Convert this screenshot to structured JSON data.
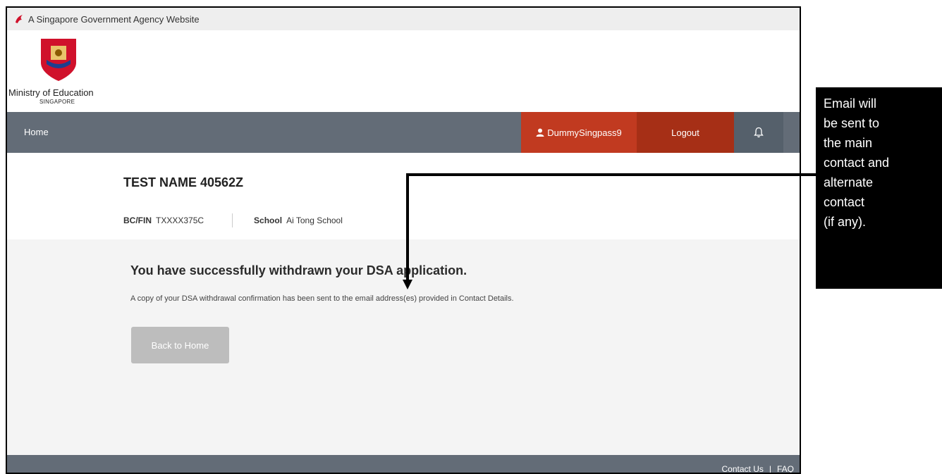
{
  "gov_banner": {
    "text": "A Singapore Government Agency Website"
  },
  "brand": {
    "name": "Ministry of Education",
    "sub": "SINGAPORE"
  },
  "nav": {
    "home": "Home",
    "user": "DummySingpass9",
    "logout": "Logout"
  },
  "profile": {
    "name": "TEST NAME 40562Z",
    "bcfin_label": "BC/FIN",
    "bcfin_value": "TXXXX375C",
    "school_label": "School",
    "school_value": "Ai Tong School"
  },
  "content": {
    "heading": "You have successfully withdrawn your DSA application.",
    "message": "A copy of your DSA withdrawal confirmation has been sent to the email address(es) provided in Contact Details.",
    "back_button": "Back to Home"
  },
  "footer": {
    "contact": "Contact Us",
    "divider": "|",
    "faq": "FAQ"
  },
  "callout": {
    "text": "Email will\nbe sent to\nthe main\ncontact and\nalternate\ncontact\n(if any)."
  },
  "colors": {
    "nav_bg": "#636c77",
    "user_bg": "#c13a20",
    "logout_bg": "#a62f16",
    "button_disabled": "#bdbdbd"
  },
  "icons": [
    "singapore-lion-icon",
    "moe-crest-icon",
    "user-icon",
    "bell-icon"
  ]
}
